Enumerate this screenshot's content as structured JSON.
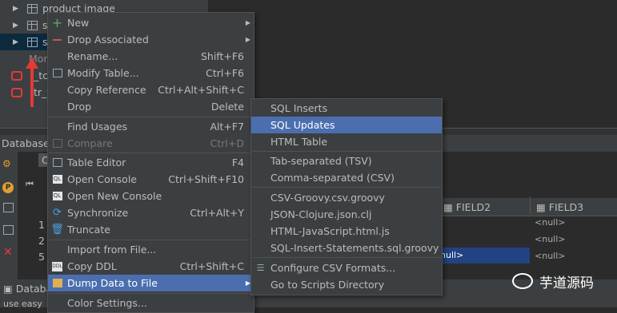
{
  "tree": {
    "rows": [
      {
        "label": "product image"
      },
      {
        "label": "s"
      },
      {
        "label": "s"
      }
    ],
    "more_label": "Mor",
    "red_rows": [
      {
        "label": "_tc"
      },
      {
        "label": "tr_t"
      }
    ]
  },
  "panel": {
    "database_label": "Database C",
    "tab_label": "Ou",
    "row_numbers": [
      "1",
      "2",
      "4",
      "5"
    ],
    "bottom_tab": "Databa",
    "status_text": "use easy"
  },
  "grid": {
    "columns": [
      "FIELD2",
      "FIELD3"
    ],
    "null_text": "<null>",
    "selected_cell": "null>"
  },
  "context_menu": {
    "items": [
      {
        "label": "New",
        "shortcut": "",
        "icon": "plus-icon",
        "submenu": true
      },
      {
        "label": "Drop Associated",
        "shortcut": "",
        "icon": "minus-icon",
        "submenu": true
      },
      {
        "label": "Rename...",
        "shortcut": "Shift+F6",
        "icon": ""
      },
      {
        "label": "Modify Table...",
        "shortcut": "Ctrl+F6",
        "icon": "table-icon"
      },
      {
        "label": "Copy Reference",
        "shortcut": "Ctrl+Alt+Shift+C",
        "icon": ""
      },
      {
        "label": "Drop",
        "shortcut": "Delete",
        "icon": ""
      },
      {
        "label": "Find Usages",
        "shortcut": "Alt+F7",
        "icon": ""
      },
      {
        "label": "Compare",
        "shortcut": "Ctrl+D",
        "icon": "compare-icon"
      },
      {
        "label": "Table Editor",
        "shortcut": "F4",
        "icon": "table-icon"
      },
      {
        "label": "Open Console",
        "shortcut": "Ctrl+Shift+F10",
        "icon": "console-icon"
      },
      {
        "label": "Open New Console",
        "shortcut": "",
        "icon": "console-icon"
      },
      {
        "label": "Synchronize",
        "shortcut": "Ctrl+Alt+Y",
        "icon": "sync-icon"
      },
      {
        "label": "Truncate",
        "shortcut": "",
        "icon": "trash-icon"
      },
      {
        "label": "Import from File...",
        "shortcut": "",
        "icon": ""
      },
      {
        "label": "Copy DDL",
        "shortcut": "Ctrl+Shift+C",
        "icon": "ddl-icon"
      },
      {
        "label": "Dump Data to File",
        "shortcut": "",
        "icon": "dump-icon",
        "submenu": true
      },
      {
        "label": "Color Settings...",
        "shortcut": "",
        "icon": ""
      }
    ]
  },
  "submenu": {
    "items": [
      {
        "label": "SQL Inserts"
      },
      {
        "label": "SQL Updates"
      },
      {
        "label": "HTML Table"
      },
      {
        "label": "Tab-separated (TSV)"
      },
      {
        "label": "Comma-separated (CSV)"
      },
      {
        "label": "CSV-Groovy.csv.groovy"
      },
      {
        "label": "JSON-Clojure.json.clj"
      },
      {
        "label": "HTML-JavaScript.html.js"
      },
      {
        "label": "SQL-Insert-Statements.sql.groovy"
      },
      {
        "label": "Configure CSV Formats..."
      },
      {
        "label": "Go to Scripts Directory"
      }
    ]
  },
  "watermark": {
    "text": "芋道源码"
  },
  "colors": {
    "highlight": "#4b6eaf",
    "menu_bg": "#3c3f41",
    "red_arrow": "#e53935"
  }
}
